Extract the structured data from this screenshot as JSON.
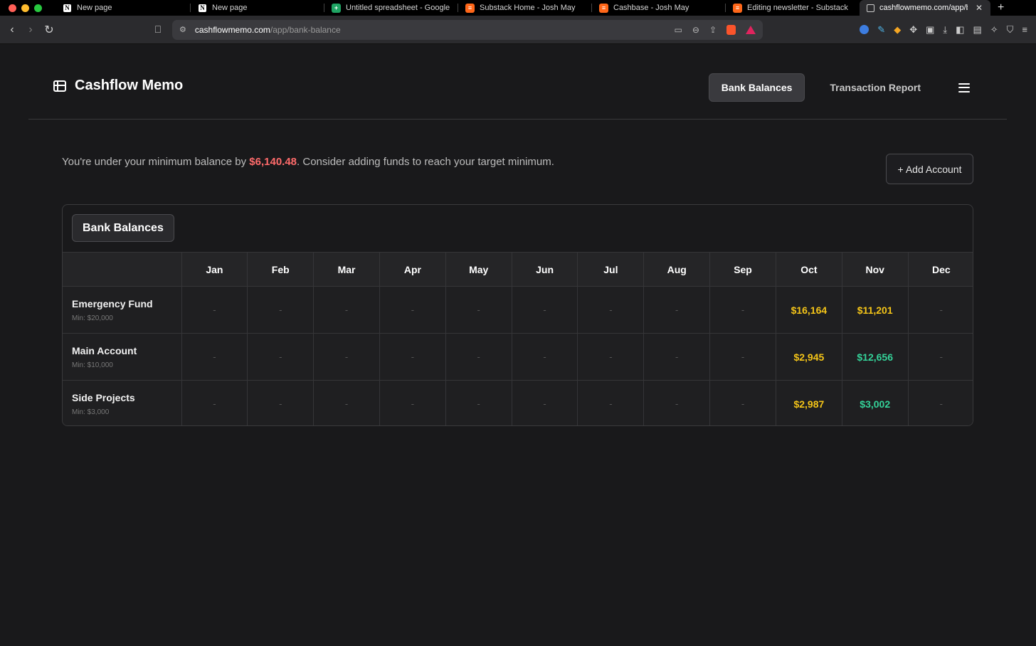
{
  "browser": {
    "tabs": [
      {
        "title": "New page",
        "icon": "notion-icon"
      },
      {
        "title": "New page",
        "icon": "notion-icon"
      },
      {
        "title": "Untitled spreadsheet - Google",
        "icon": "google-sheets-icon"
      },
      {
        "title": "Substack Home - Josh May",
        "icon": "substack-icon"
      },
      {
        "title": "Cashbase - Josh May",
        "icon": "substack-icon"
      },
      {
        "title": "Editing newsletter - Substack",
        "icon": "substack-icon"
      },
      {
        "title": "cashflowmemo.com/app/b",
        "icon": "grid-icon",
        "active": true
      }
    ],
    "url_host": "cashflowmemo.com",
    "url_path": "/app/bank-balance"
  },
  "header": {
    "brand": "Cashflow Memo",
    "nav": [
      "Bank Balances",
      "Transaction Report"
    ],
    "active_nav": "Bank Balances"
  },
  "notice": {
    "prefix": "You're under your minimum balance by ",
    "amount": "$6,140.48",
    "suffix": ". Consider adding funds to reach your target minimum."
  },
  "add_account_label": "+ Add Account",
  "table": {
    "title": "Bank Balances",
    "months": [
      "Jan",
      "Feb",
      "Mar",
      "Apr",
      "May",
      "Jun",
      "Jul",
      "Aug",
      "Sep",
      "Oct",
      "Nov",
      "Dec"
    ],
    "rows": [
      {
        "name": "Emergency Fund",
        "min": "Min: $20,000",
        "values": [
          "-",
          "-",
          "-",
          "-",
          "-",
          "-",
          "-",
          "-",
          "-",
          "$16,164",
          "$11,201",
          "-"
        ],
        "status": [
          "",
          "",
          "",
          "",
          "",
          "",
          "",
          "",
          "",
          "yellow",
          "yellow",
          ""
        ]
      },
      {
        "name": "Main Account",
        "min": "Min: $10,000",
        "values": [
          "-",
          "-",
          "-",
          "-",
          "-",
          "-",
          "-",
          "-",
          "-",
          "$2,945",
          "$12,656",
          "-"
        ],
        "status": [
          "",
          "",
          "",
          "",
          "",
          "",
          "",
          "",
          "",
          "yellow",
          "green",
          ""
        ]
      },
      {
        "name": "Side Projects",
        "min": "Min: $3,000",
        "values": [
          "-",
          "-",
          "-",
          "-",
          "-",
          "-",
          "-",
          "-",
          "-",
          "$2,987",
          "$3,002",
          "-"
        ],
        "status": [
          "",
          "",
          "",
          "",
          "",
          "",
          "",
          "",
          "",
          "yellow",
          "green",
          ""
        ]
      }
    ]
  },
  "colors": {
    "below_min": "#f5c518",
    "above_min": "#34d399",
    "shortfall": "#ff6b6b"
  }
}
